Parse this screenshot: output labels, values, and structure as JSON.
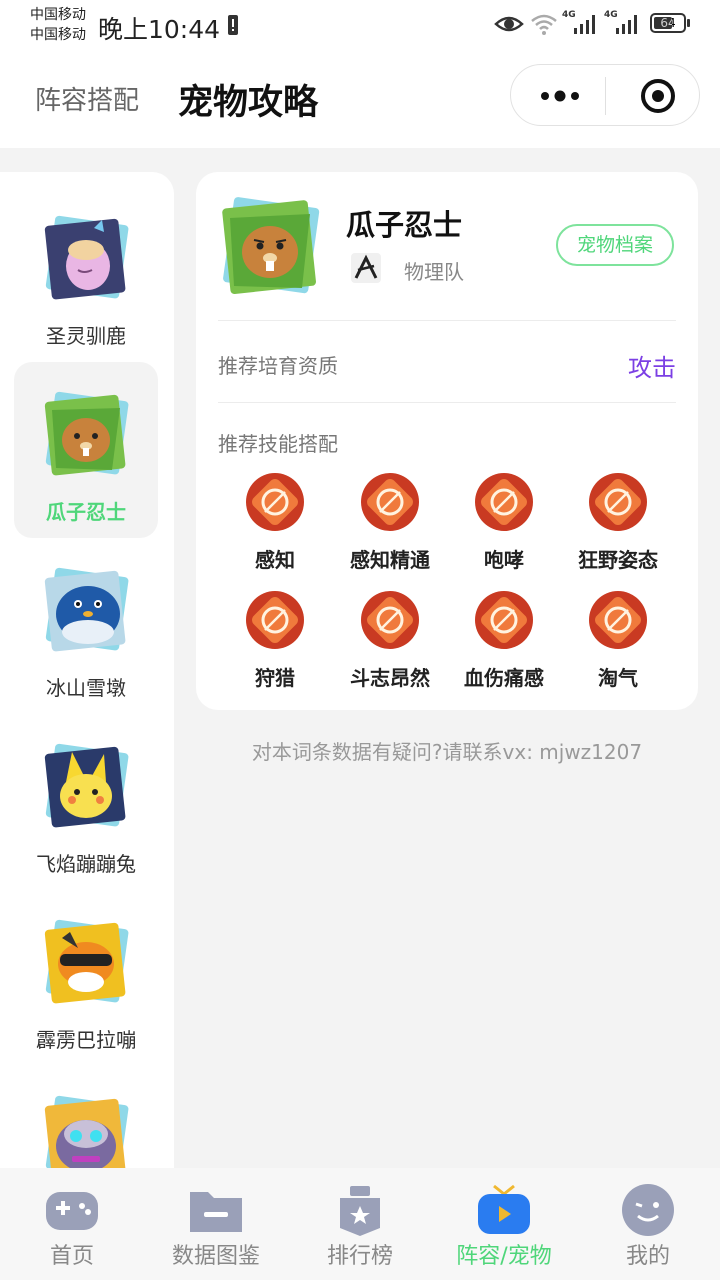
{
  "status_bar": {
    "carrier_1": "中国移动",
    "carrier_2": "中国移动",
    "time": "晚上10:44",
    "signal_1": "4G",
    "signal_2": "4G",
    "battery": "64"
  },
  "header": {
    "tab_lineup": "阵容搭配",
    "tab_guide": "宠物攻略"
  },
  "sidebar": {
    "items": [
      {
        "label": "圣灵驯鹿",
        "icon": "reindeer-pet-icon"
      },
      {
        "label": "瓜子忍士",
        "icon": "melon-ninja-pet-icon"
      },
      {
        "label": "冰山雪墩",
        "icon": "penguin-pet-icon"
      },
      {
        "label": "飞焰蹦蹦兔",
        "icon": "flame-bunny-pet-icon"
      },
      {
        "label": "霹雳巴拉嘣",
        "icon": "thunder-pet-icon"
      },
      {
        "label": "",
        "icon": "robot-pet-icon"
      }
    ],
    "active_index": 1
  },
  "pet": {
    "name": "瓜子忍士",
    "team": "物理队",
    "archive_button": "宠物档案",
    "quality_label": "推荐培育资质",
    "quality_value": "攻击",
    "skills_label": "推荐技能搭配",
    "skills": [
      "感知",
      "感知精通",
      "咆哮",
      "狂野姿态",
      "狩猎",
      "斗志昂然",
      "血伤痛感",
      "淘气"
    ]
  },
  "contact": "对本词条数据有疑问?请联系vx: mjwz1207",
  "bottom_nav": {
    "items": [
      {
        "label": "首页",
        "icon": "gamepad-icon"
      },
      {
        "label": "数据图鉴",
        "icon": "folder-icon"
      },
      {
        "label": "排行榜",
        "icon": "badge-icon"
      },
      {
        "label": "阵容/宠物",
        "icon": "tv-icon"
      },
      {
        "label": "我的",
        "icon": "face-icon"
      }
    ],
    "active_index": 3
  },
  "colors": {
    "accent_green": "#4fd67a",
    "accent_purple": "#7b3fe4",
    "skill_orange": "#e8552b"
  }
}
